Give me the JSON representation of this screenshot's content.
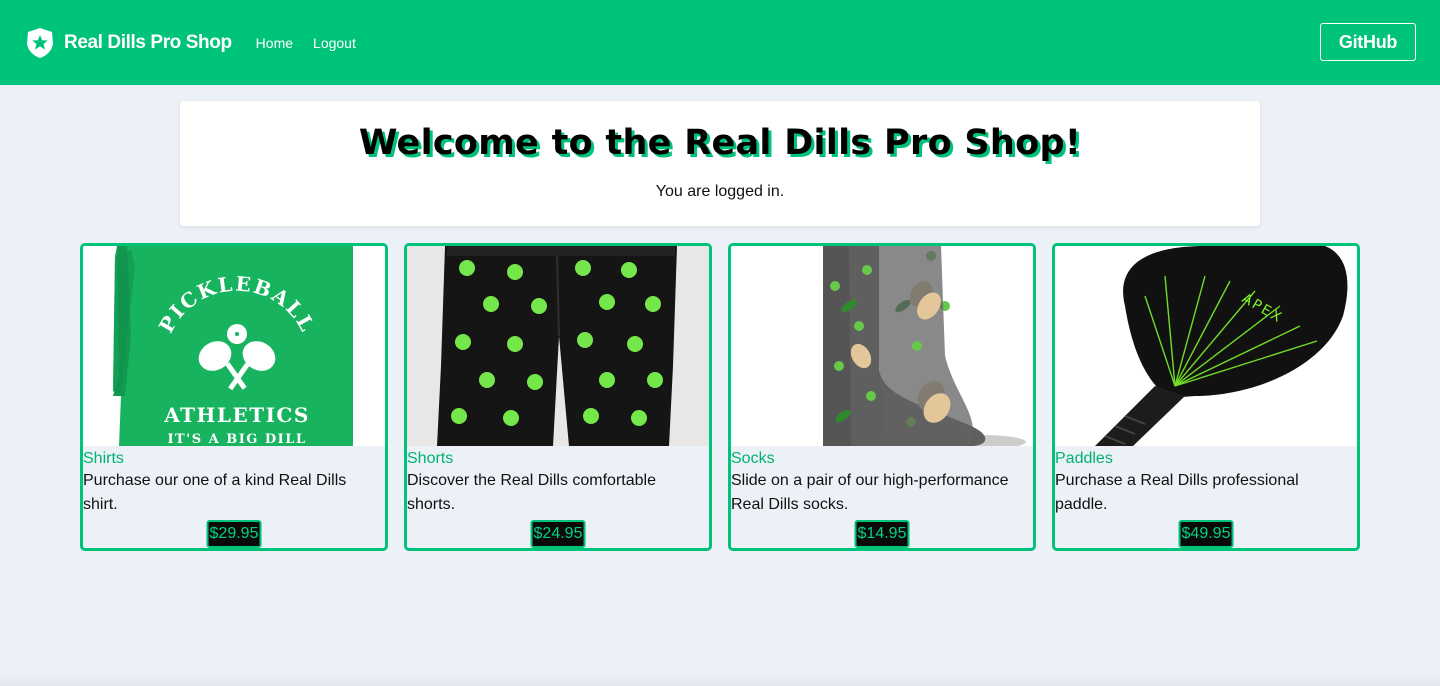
{
  "nav": {
    "brand": "Real Dills Pro Shop",
    "logo_icon": "auth0-star-shield-icon",
    "links": [
      "Home",
      "Logout"
    ],
    "github": "GitHub"
  },
  "welcome": {
    "title": "Welcome to the Real Dills Pro Shop!",
    "status": "You are logged in."
  },
  "products": [
    {
      "title": "Shirts",
      "description": "Purchase our one of a kind Real Dills shirt.",
      "price": "$29.95",
      "image": "pickleball-shirt-image",
      "image_text": [
        "PICKLEBALL",
        "ATHLETICS",
        "IT'S A BIG DILL"
      ]
    },
    {
      "title": "Shorts",
      "description": "Discover the Real Dills comfortable shorts.",
      "price": "$24.95",
      "image": "pickleball-shorts-image"
    },
    {
      "title": "Socks",
      "description": "Slide on a pair of our high-performance Real Dills socks.",
      "price": "$14.95",
      "image": "pickle-socks-image"
    },
    {
      "title": "Paddles",
      "description": "Purchase a Real Dills professional paddle.",
      "price": "$49.95",
      "image": "pickleball-paddle-image",
      "image_text": [
        "APEX"
      ]
    }
  ],
  "colors": {
    "brand_green": "#00c37a",
    "page_bg": "#ecf0f7",
    "price_bg": "#0a0a0a",
    "price_text": "#00d283"
  }
}
